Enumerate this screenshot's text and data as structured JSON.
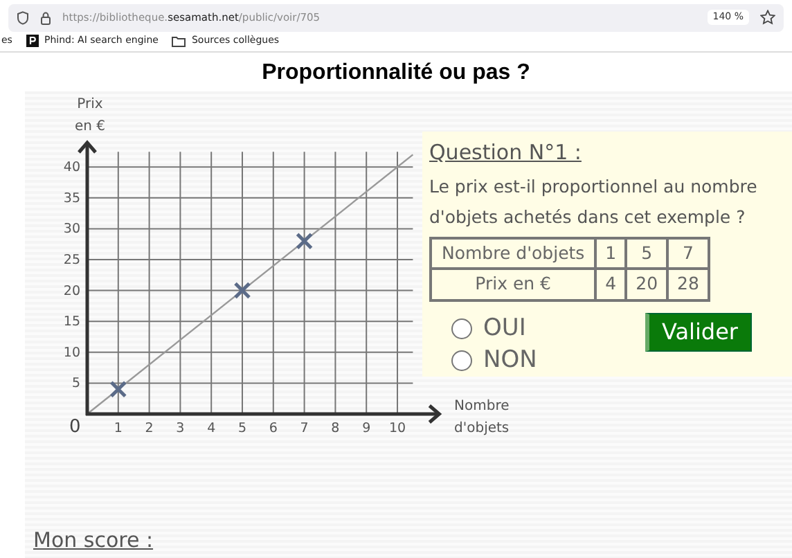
{
  "browser": {
    "url_prefix": "https://bibliotheque.",
    "url_domain": "sesamath.net",
    "url_path": "/public/voir/705",
    "zoom": "140 %",
    "bookmarks": [
      {
        "kind": "cut",
        "label": "es"
      },
      {
        "kind": "site",
        "label": "Phind: AI search engine"
      },
      {
        "kind": "folder",
        "label": "Sources collègues"
      }
    ]
  },
  "page_title": "Proportionnalité ou pas ?",
  "graph": {
    "origin_label": "0",
    "chart_data": {
      "type": "scatter",
      "xlabel": "Nombre d'objets",
      "ylabel": "Prix en €",
      "x": [
        1,
        5,
        7
      ],
      "series": [
        {
          "color": "#5b6b88",
          "values": [
            4,
            20,
            28
          ]
        }
      ],
      "grid": true,
      "xlim": [
        0,
        10.5
      ],
      "ylim": [
        0,
        42
      ],
      "xticks": [
        1,
        2,
        3,
        4,
        5,
        6,
        7,
        8,
        9,
        10
      ],
      "yticks": [
        5,
        10,
        15,
        20,
        25,
        30,
        35,
        40
      ]
    }
  },
  "question": {
    "title": "Question N°1 :",
    "text": "Le prix est-il proportionnel au nombre d'objets achetés dans cet exemple ?",
    "table": {
      "rows": [
        [
          "Nombre d'objets",
          "1",
          "5",
          "7"
        ],
        [
          "Prix en €",
          "4",
          "20",
          "28"
        ]
      ]
    },
    "options": [
      {
        "label": "OUI",
        "selected": false
      },
      {
        "label": "NON",
        "selected": false
      }
    ],
    "submit": "Valider"
  },
  "score_label": "Mon score :"
}
